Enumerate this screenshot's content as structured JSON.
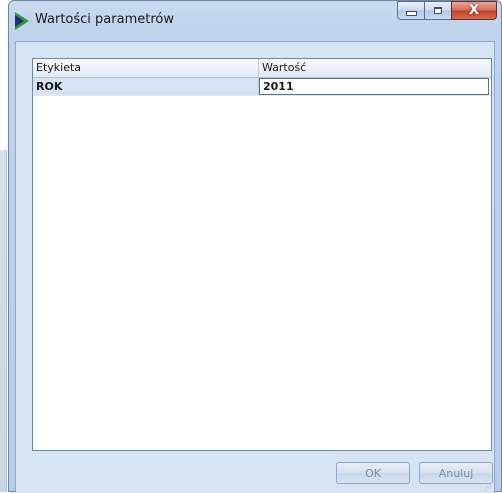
{
  "window": {
    "title": "Wartości parametrów",
    "close_glyph": "X"
  },
  "grid": {
    "columns": [
      "Etykieta",
      "Wartość"
    ],
    "rows": [
      {
        "label": "ROK",
        "value": "2011"
      }
    ]
  },
  "buttons": {
    "ok_label": "OK",
    "cancel_label": "Anuluj"
  },
  "icons": {
    "app": "app-arrow-icon",
    "minimize": "minimize-icon",
    "maximize": "maximize-icon",
    "close": "close-icon"
  },
  "colors": {
    "titlebar": "#c9daf0",
    "close_button": "#c2432a",
    "selected_label_cell": "#d6e3f5"
  }
}
